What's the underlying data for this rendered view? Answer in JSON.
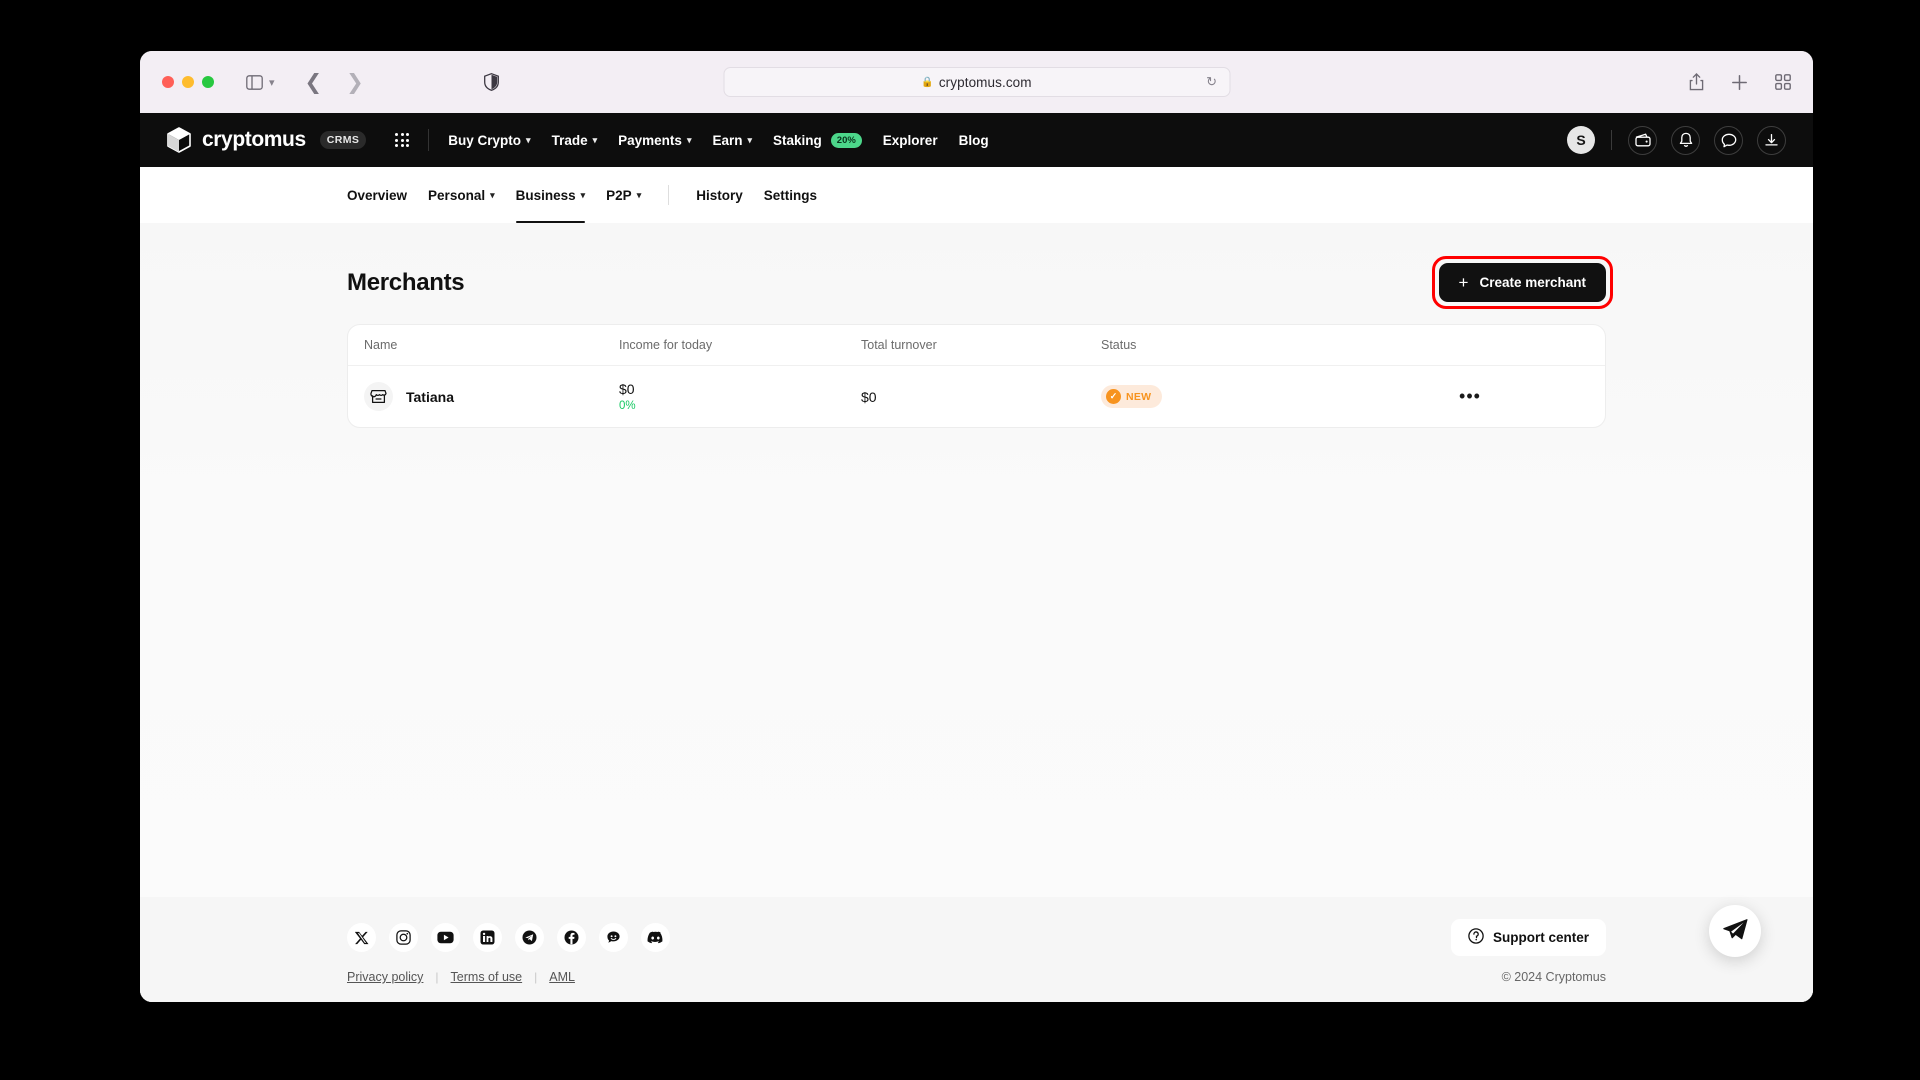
{
  "browser": {
    "url": "cryptomus.com",
    "lock_icon": "lock-icon",
    "reload_icon": "reload-icon",
    "share_icon": "share-icon",
    "newtab_icon": "plus-icon",
    "tabs_icon": "tab-overview-icon",
    "sidebar_icon": "sidebar-icon",
    "back_icon": "back-arrow-icon",
    "forward_icon": "forward-arrow-icon",
    "shield_icon": "privacy-shield-icon"
  },
  "topnav": {
    "brand": "cryptomus",
    "brand_badge": "CRMS",
    "apps_icon": "app-grid-icon",
    "links": [
      {
        "label": "Buy Crypto",
        "caret": true
      },
      {
        "label": "Trade",
        "caret": true
      },
      {
        "label": "Payments",
        "caret": true
      },
      {
        "label": "Earn",
        "caret": true
      },
      {
        "label": "Staking",
        "caret": false,
        "badge": "20%"
      },
      {
        "label": "Explorer",
        "caret": false
      },
      {
        "label": "Blog",
        "caret": false
      }
    ],
    "avatar_initial": "S",
    "icons": [
      "wallet-icon",
      "bell-icon",
      "chat-icon",
      "download-icon"
    ],
    "badge_color": "#4cd68a"
  },
  "subnav": {
    "tabs": [
      {
        "label": "Overview",
        "caret": false,
        "active": false
      },
      {
        "label": "Personal",
        "caret": true,
        "active": false
      },
      {
        "label": "Business",
        "caret": true,
        "active": true
      },
      {
        "label": "P2P",
        "caret": true,
        "active": false
      }
    ],
    "tabs_right": [
      {
        "label": "History"
      },
      {
        "label": "Settings"
      }
    ]
  },
  "main": {
    "title": "Merchants",
    "create_button": "Create merchant",
    "create_button_icon": "plus-icon",
    "highlight_color": "#ff0000",
    "table": {
      "headers": [
        "Name",
        "Income for today",
        "Total turnover",
        "Status"
      ],
      "rows": [
        {
          "name": "Tatiana",
          "icon": "store-icon",
          "income": "$0",
          "income_pct": "0%",
          "income_pct_color": "#18c964",
          "turnover": "$0",
          "status": "NEW",
          "status_color": "#f7931e",
          "status_bg": "#fdeadb",
          "menu_icon": "more-options-icon"
        }
      ]
    }
  },
  "footer": {
    "socials": [
      "x-icon",
      "instagram-icon",
      "youtube-icon",
      "linkedin-icon",
      "telegram-icon",
      "facebook-icon",
      "reddit-icon",
      "discord-icon"
    ],
    "support_label": "Support center",
    "support_icon": "question-circle-icon",
    "links": [
      "Privacy policy",
      "Terms of use",
      "AML"
    ],
    "divider": "|",
    "copyright": "© 2024 Cryptomus"
  },
  "fab": {
    "icon": "telegram-icon"
  }
}
